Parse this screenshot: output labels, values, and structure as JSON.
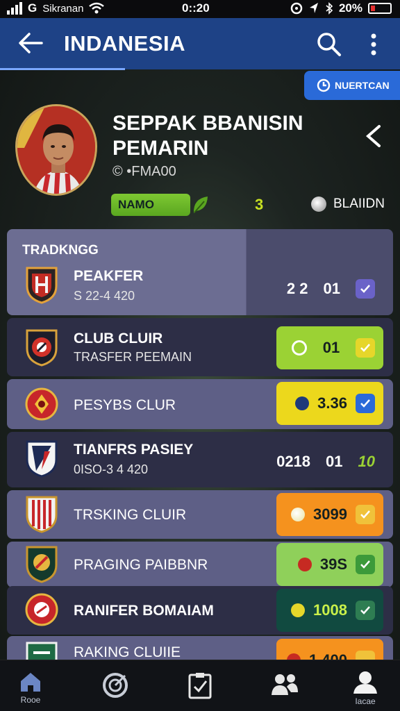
{
  "status": {
    "carrier": "Sikranan",
    "time": "0::20",
    "battery": "20%"
  },
  "appbar": {
    "title": "INDANESIA",
    "back_icon": "arrow-left-icon",
    "search_icon": "search-icon",
    "more_icon": "more-vert-icon"
  },
  "notify_button": {
    "label": "NUERTCAN"
  },
  "profile": {
    "name_line1": "SEPPAK BBANISIN",
    "name_line2": "PEMARIN",
    "subtitle": "© •FMA00",
    "pill": "NAMO",
    "count": "3",
    "right_label": "BLAIIDN"
  },
  "list": {
    "section_title": "TRADKNGG",
    "rows": [
      {
        "title": "PEAKFER",
        "subtitle": "S 22-4 420",
        "v1": "2 2",
        "v2": "01"
      },
      {
        "title": "CLUB CLUIR",
        "subtitle": "TRASFER PEEMAIN",
        "value": "01"
      },
      {
        "title": "PESYBS CLUR",
        "value": "3.36"
      },
      {
        "title": "TIANFRS PASIEY",
        "subtitle": "0ISO-3 4 420",
        "v1": "0218",
        "v2": "01",
        "v3": "10"
      },
      {
        "title": "TRSKING CLUIR",
        "value": "3099"
      },
      {
        "title": "PRAGING PAIBBNR",
        "value": "39S"
      },
      {
        "title": "RANIFER BOMAIAM",
        "value": "1008"
      },
      {
        "title": "RAKING CLUIIE",
        "value": "1 400"
      }
    ]
  },
  "bottom_nav": {
    "home": "Rooe",
    "profile": "Iacae"
  },
  "colors": {
    "appbar": "#1e4286",
    "green": "#9bd234",
    "yellow": "#ecd81c",
    "orange": "#f5921e",
    "teal": "#114a40",
    "accent_blue": "#2a6ad8"
  }
}
